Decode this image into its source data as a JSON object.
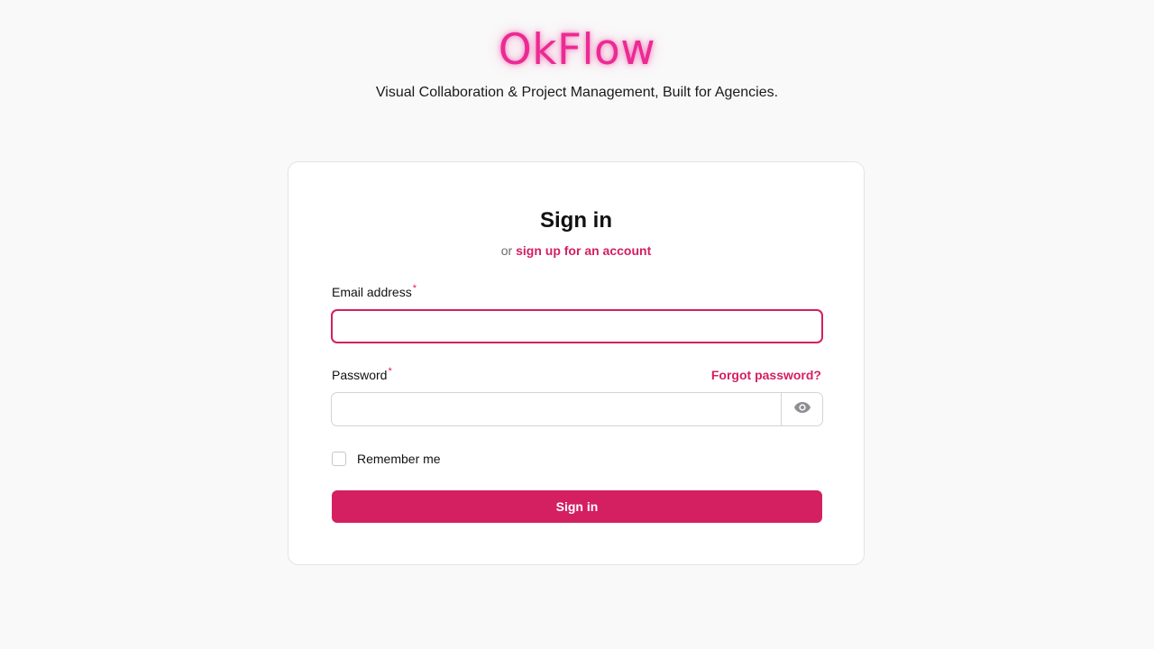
{
  "brand": {
    "logo_text": "OkFlow",
    "tagline": "Visual Collaboration & Project Management, Built for Agencies.",
    "accent_color": "#d41f61",
    "logo_color": "#ec2a93"
  },
  "signin": {
    "title": "Sign in",
    "sub_prefix": "or",
    "signup_link": "sign up for an account",
    "email": {
      "label": "Email address",
      "required_mark": "*",
      "value": "",
      "placeholder": ""
    },
    "password": {
      "label": "Password",
      "required_mark": "*",
      "value": "",
      "placeholder": "",
      "forgot_link": "Forgot password?",
      "toggle_icon": "eye-icon"
    },
    "remember_me": {
      "label": "Remember me",
      "checked": false
    },
    "submit_label": "Sign in"
  }
}
